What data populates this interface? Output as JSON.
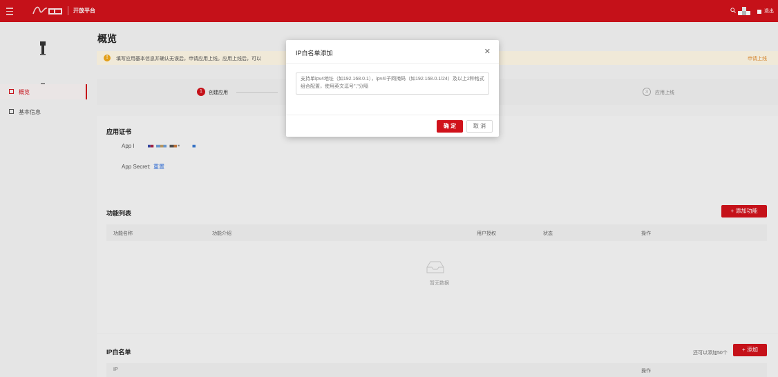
{
  "topbar": {
    "platform_label": "开放平台",
    "logout_label": "退出",
    "logo_text": "学习强国"
  },
  "sidebar": {
    "items": [
      {
        "label": "概览",
        "icon": "grid-icon",
        "active": true
      },
      {
        "label": "基本信息",
        "icon": "list-icon",
        "active": false
      }
    ]
  },
  "main": {
    "page_title": "概览",
    "notice": {
      "text": "填写应用基本信息并确认无误后，申请应用上线。应用上线后，可以",
      "action_label": "申请上线"
    },
    "steps": [
      {
        "number": "1",
        "label": "创建应用",
        "state": "active"
      },
      {
        "number": "3",
        "label": "应用上线",
        "state": "pending"
      }
    ],
    "cert": {
      "title": "应用证书",
      "app_id_label": "App I",
      "app_secret_label": "App Secret:",
      "reset_label": "重置"
    },
    "features": {
      "title": "功能列表",
      "add_label": "+ 添加功能",
      "columns": [
        "功能名称",
        "功能介绍",
        "用户授权",
        "状态",
        "操作"
      ],
      "empty_text": "暂无数据"
    },
    "whitelist": {
      "title": "IP白名单",
      "quota_text": "还可以添加50个",
      "add_label": "+ 添加",
      "columns": [
        "IP",
        "操作"
      ]
    }
  },
  "modal": {
    "title": "IP白名单添加",
    "placeholder": "支持单ipv4地址（如192.168.0.1），ipv4/子网掩码（如192.168.0.1/24）及以上2种格式组合配置，使用英文逗号\",\"分隔",
    "ok_label": "确 定",
    "cancel_label": "取 消"
  },
  "colors": {
    "brand": "#d0121b",
    "warning": "#f0a81c",
    "link": "#2f6fdc"
  }
}
